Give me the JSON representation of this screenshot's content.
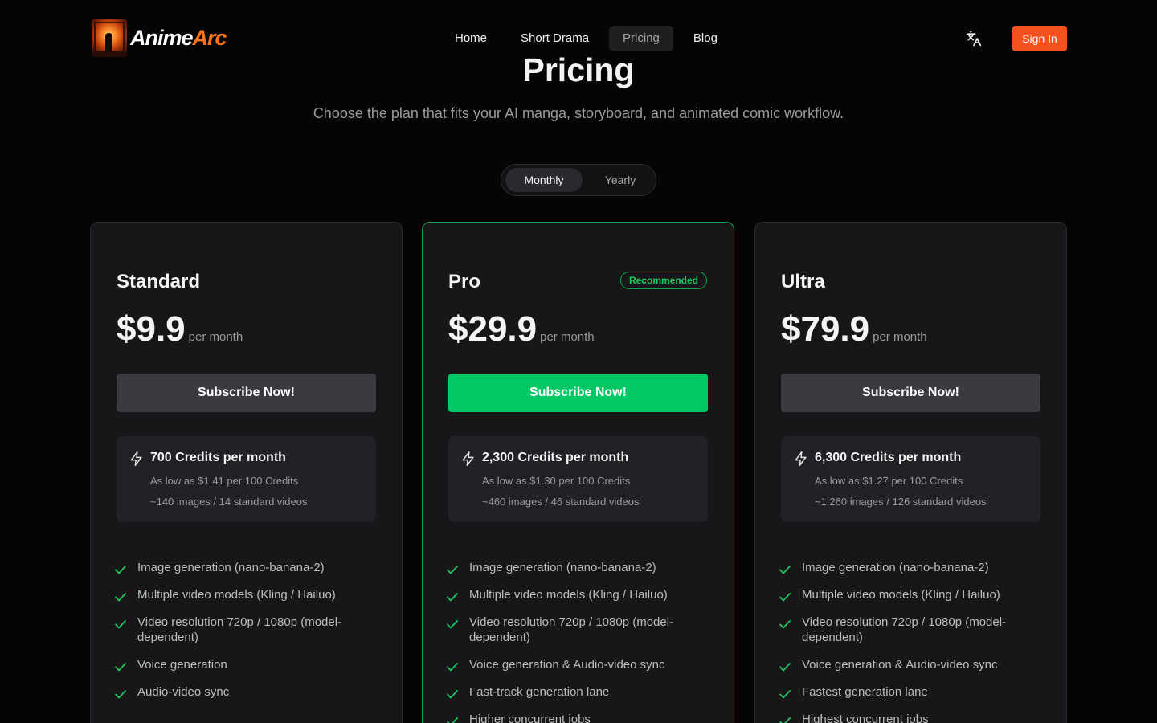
{
  "header": {
    "logo_text_a": "Anime",
    "logo_text_b": "Arc",
    "nav": [
      {
        "label": "Home",
        "active": false
      },
      {
        "label": "Short Drama",
        "active": false
      },
      {
        "label": "Pricing",
        "active": true
      },
      {
        "label": "Blog",
        "active": false
      }
    ],
    "translate_icon": "translate-icon",
    "signin_label": "Sign In"
  },
  "hero": {
    "title": "Pricing",
    "subtitle": "Choose the plan that fits your AI manga, storyboard, and animated comic workflow."
  },
  "billing_toggle": {
    "monthly": "Monthly",
    "yearly": "Yearly",
    "selected": "Monthly"
  },
  "plans": [
    {
      "name": "Standard",
      "badge": "",
      "price": "$9.9",
      "period": "per month",
      "cta": "Subscribe Now!",
      "credits_title": "700 Credits per month",
      "credits_rate": "As low as $1.41 per 100 Credits",
      "credits_estimate": "~140 images / 14 standard videos",
      "features": [
        "Image generation (nano-banana-2)",
        "Multiple video models (Kling / Hailuo)",
        "Video resolution 720p / 1080p (model-dependent)",
        "Voice generation",
        "Audio-video sync"
      ]
    },
    {
      "name": "Pro",
      "badge": "Recommended",
      "price": "$29.9",
      "period": "per month",
      "cta": "Subscribe Now!",
      "credits_title": "2,300 Credits per month",
      "credits_rate": "As low as $1.30 per 100 Credits",
      "credits_estimate": "~460 images / 46 standard videos",
      "features": [
        "Image generation (nano-banana-2)",
        "Multiple video models (Kling / Hailuo)",
        "Video resolution 720p / 1080p (model-dependent)",
        "Voice generation & Audio-video sync",
        "Fast-track generation lane",
        "Higher concurrent jobs"
      ]
    },
    {
      "name": "Ultra",
      "badge": "",
      "price": "$79.9",
      "period": "per month",
      "cta": "Subscribe Now!",
      "credits_title": "6,300 Credits per month",
      "credits_rate": "As low as $1.27 per 100 Credits",
      "credits_estimate": "~1,260 images / 126 standard videos",
      "features": [
        "Image generation (nano-banana-2)",
        "Multiple video models (Kling / Hailuo)",
        "Video resolution 720p / 1080p (model-dependent)",
        "Voice generation & Audio-video sync",
        "Fastest generation lane",
        "Highest concurrent jobs"
      ]
    }
  ],
  "colors": {
    "accent_orange": "#f4511e",
    "accent_green": "#00c864",
    "background": "#050505",
    "card": "#17171a"
  }
}
